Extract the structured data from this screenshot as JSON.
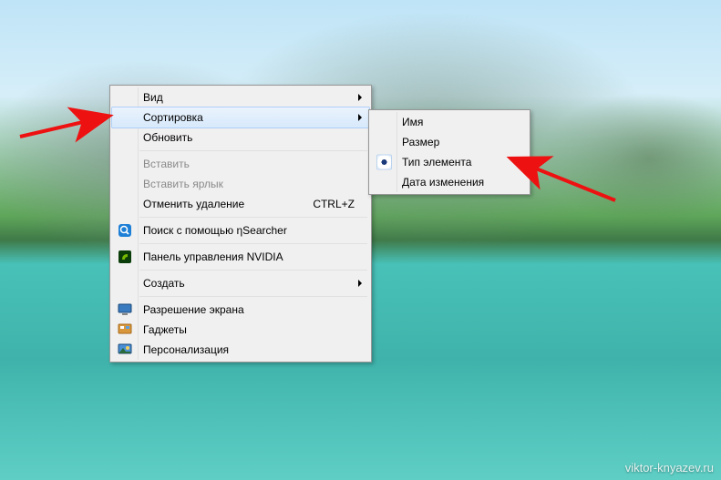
{
  "main_menu": {
    "view": "Вид",
    "sort": "Сортировка",
    "refresh": "Обновить",
    "paste": "Вставить",
    "paste_shortcut": "Вставить ярлык",
    "undo_delete": "Отменить удаление",
    "undo_delete_key": "CTRL+Z",
    "search": "Поиск с помощью ηSearcher",
    "nvidia": "Панель управления NVIDIA",
    "create": "Создать",
    "screen_res": "Разрешение экрана",
    "gadgets": "Гаджеты",
    "personalize": "Персонализация"
  },
  "sub_menu": {
    "name": "Имя",
    "size": "Размер",
    "item_type": "Тип элемента",
    "date_modified": "Дата изменения"
  },
  "watermark": "viktor-knyazev.ru"
}
